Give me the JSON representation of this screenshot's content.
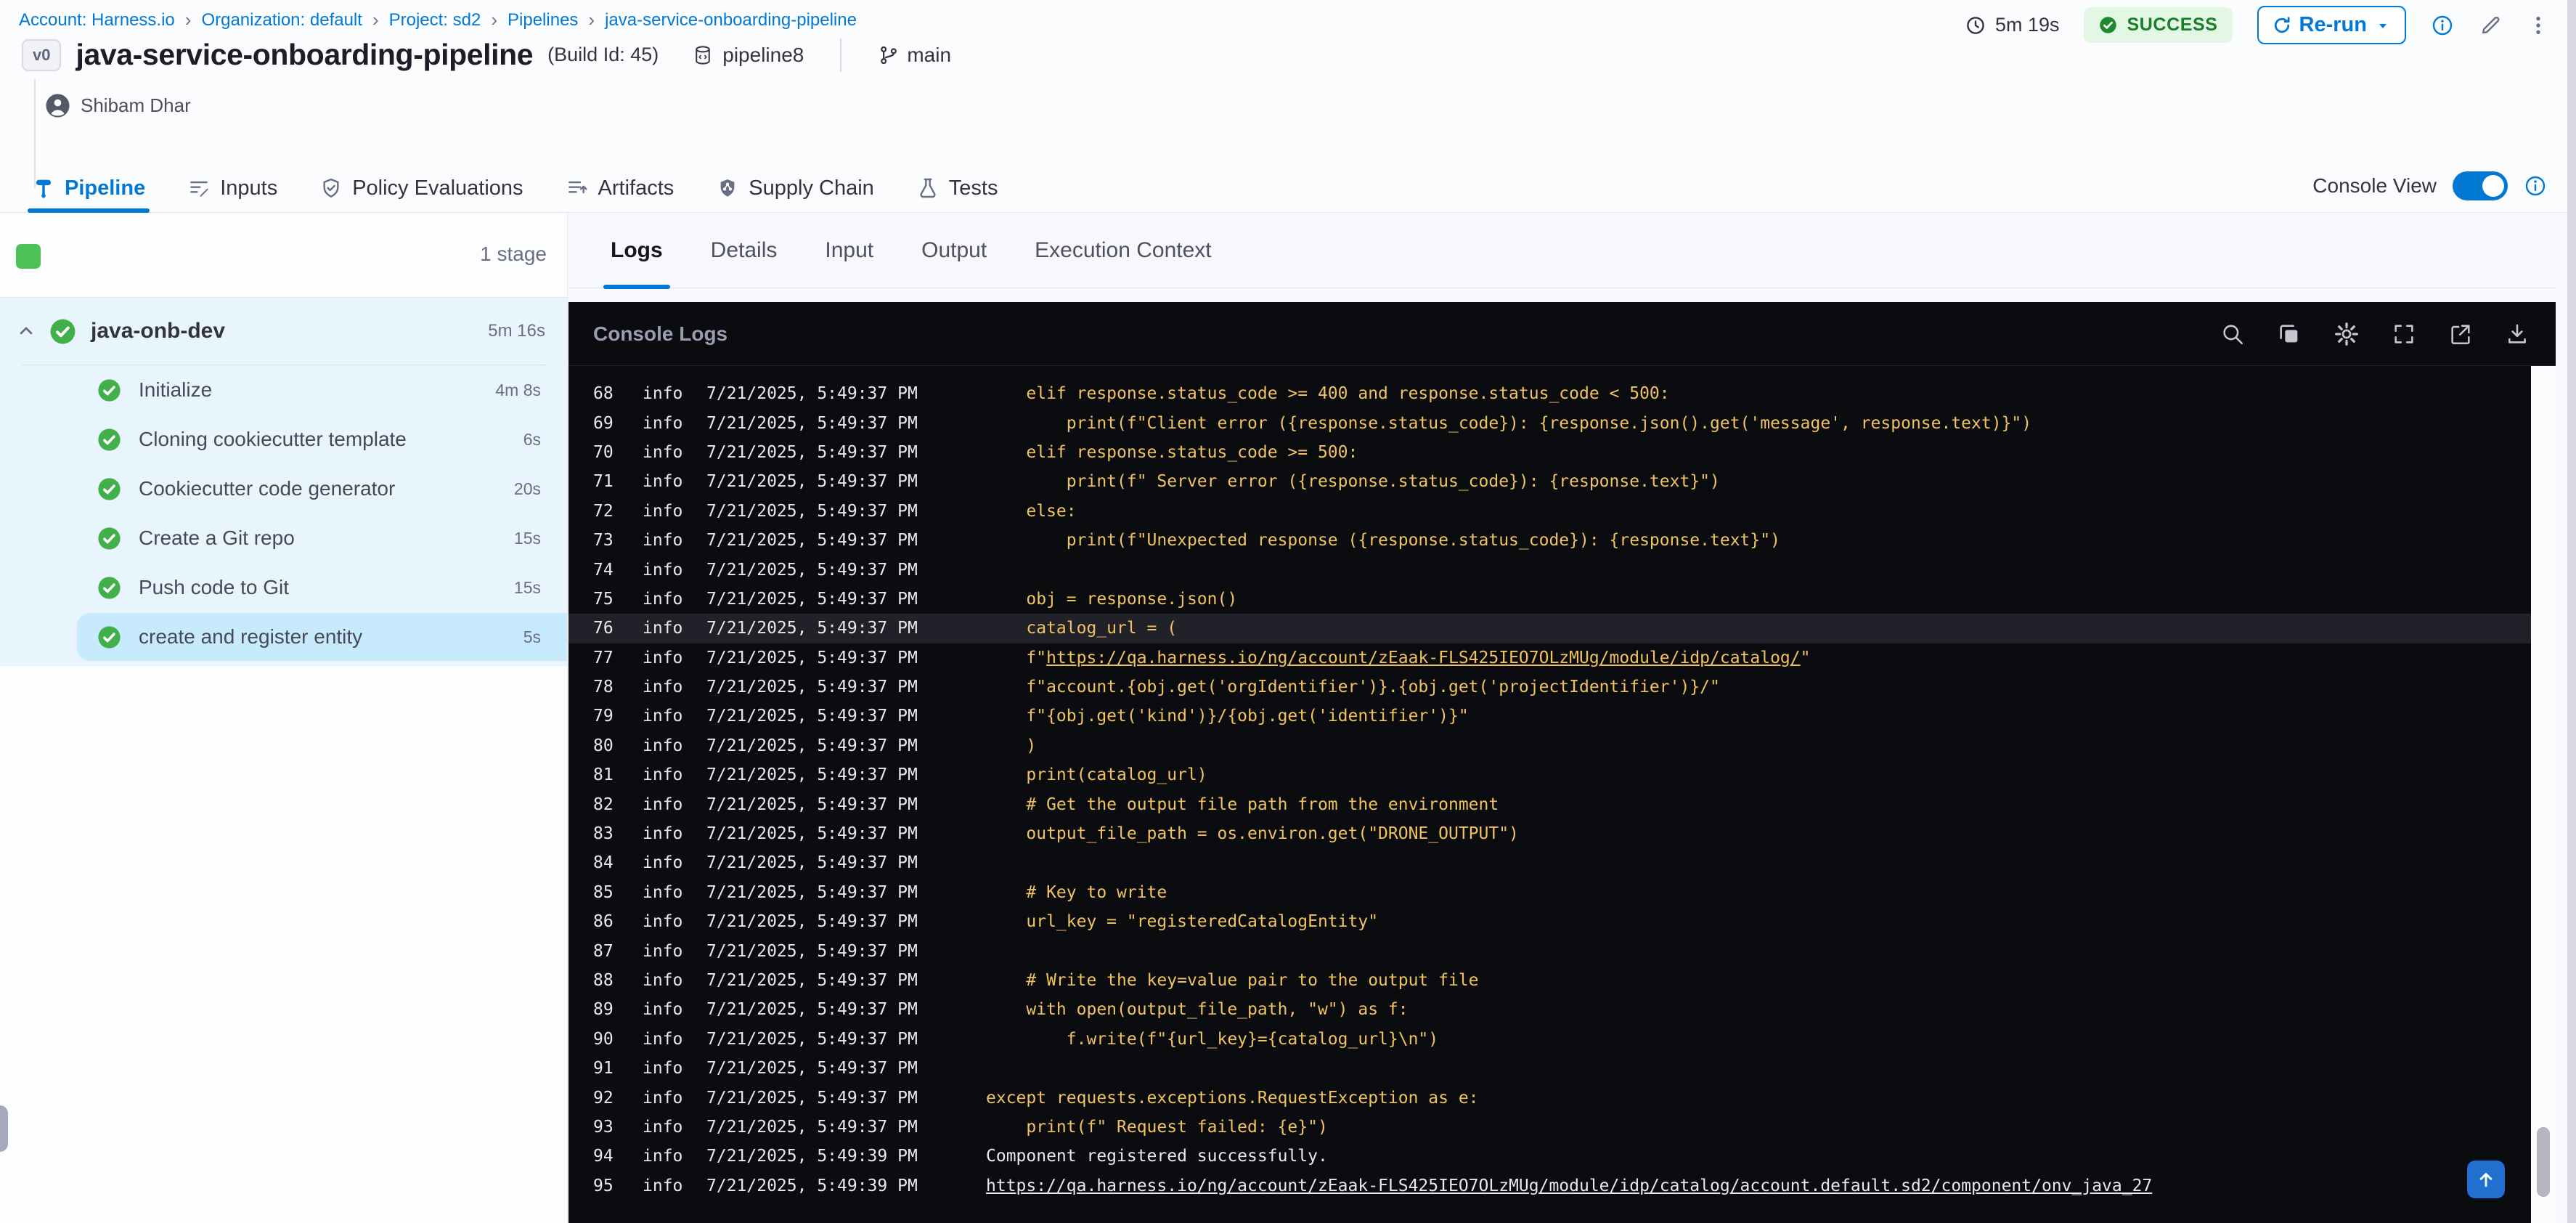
{
  "colors": {
    "accent_blue": "#0278d5",
    "success_green": "#42b04a",
    "log_yellow": "#f1c360",
    "console_bg": "#0b0c10",
    "highlight_row_bg": "#202129",
    "selected_step_bg": "#c7ebfd",
    "stage_block_bg": "#e9f5fc"
  },
  "breadcrumb": {
    "separator": "›",
    "items": [
      "Account: Harness.io",
      "Organization: default",
      "Project: sd2",
      "Pipelines",
      "java-service-onboarding-pipeline"
    ]
  },
  "topbar": {
    "duration": "5m 19s",
    "status_label": "SUCCESS",
    "rerun_label": "Re-run"
  },
  "header": {
    "version_badge": "v0",
    "title": "java-service-onboarding-pipeline",
    "build_id": "(Build Id: 45)",
    "pipeline_chip": "pipeline8",
    "branch": "main",
    "user": "Shibam Dhar"
  },
  "main_tabs": [
    {
      "label": "Pipeline",
      "icon": "pipeline-icon",
      "active": true
    },
    {
      "label": "Inputs",
      "icon": "inputs-icon",
      "active": false
    },
    {
      "label": "Policy Evaluations",
      "icon": "policy-shield-icon",
      "active": false
    },
    {
      "label": "Artifacts",
      "icon": "artifacts-icon",
      "active": false
    },
    {
      "label": "Supply Chain",
      "icon": "supply-chain-shield-icon",
      "active": false
    },
    {
      "label": "Tests",
      "icon": "tests-flask-icon",
      "active": false
    }
  ],
  "tabsbar": {
    "console_view_label": "Console View",
    "console_view_enabled": true
  },
  "sidebar": {
    "stage_count_label": "1 stage",
    "stage": {
      "name": "java-onb-dev",
      "duration": "5m 16s",
      "status": "success"
    },
    "steps": [
      {
        "name": "Initialize",
        "duration": "4m 8s",
        "status": "success",
        "selected": false
      },
      {
        "name": "Cloning cookiecutter template",
        "duration": "6s",
        "status": "success",
        "selected": false
      },
      {
        "name": "Cookiecutter code generator",
        "duration": "20s",
        "status": "success",
        "selected": false
      },
      {
        "name": "Create a Git repo",
        "duration": "15s",
        "status": "success",
        "selected": false
      },
      {
        "name": "Push code to Git",
        "duration": "15s",
        "status": "success",
        "selected": false
      },
      {
        "name": "create and register entity",
        "duration": "5s",
        "status": "success",
        "selected": true
      }
    ]
  },
  "detail_tabs": [
    {
      "label": "Logs",
      "active": true
    },
    {
      "label": "Details",
      "active": false
    },
    {
      "label": "Input",
      "active": false
    },
    {
      "label": "Output",
      "active": false
    },
    {
      "label": "Execution Context",
      "active": false
    }
  ],
  "console": {
    "title": "Console Logs",
    "toolbar_icons": [
      "search-icon",
      "copy-icon",
      "settings-gear-icon",
      "fullscreen-icon",
      "open-in-new-icon",
      "download-icon"
    ],
    "lines": [
      {
        "n": 68,
        "level": "info",
        "ts": "7/21/2025, 5:49:37 PM",
        "kind": "code",
        "highlight": false,
        "segments": [
          {
            "text": "    elif response.status_code >= 400 and response.status_code < 500:"
          }
        ]
      },
      {
        "n": 69,
        "level": "info",
        "ts": "7/21/2025, 5:49:37 PM",
        "kind": "code",
        "highlight": false,
        "segments": [
          {
            "text": "        print(f\"Client error ({response.status_code}): {response.json().get('message', response.text)}\")"
          }
        ]
      },
      {
        "n": 70,
        "level": "info",
        "ts": "7/21/2025, 5:49:37 PM",
        "kind": "code",
        "highlight": false,
        "segments": [
          {
            "text": "    elif response.status_code >= 500:"
          }
        ]
      },
      {
        "n": 71,
        "level": "info",
        "ts": "7/21/2025, 5:49:37 PM",
        "kind": "code",
        "highlight": false,
        "segments": [
          {
            "text": "        print(f\" Server error ({response.status_code}): {response.text}\")"
          }
        ]
      },
      {
        "n": 72,
        "level": "info",
        "ts": "7/21/2025, 5:49:37 PM",
        "kind": "code",
        "highlight": false,
        "segments": [
          {
            "text": "    else:"
          }
        ]
      },
      {
        "n": 73,
        "level": "info",
        "ts": "7/21/2025, 5:49:37 PM",
        "kind": "code",
        "highlight": false,
        "segments": [
          {
            "text": "        print(f\"Unexpected response ({response.status_code}): {response.text}\")"
          }
        ]
      },
      {
        "n": 74,
        "level": "info",
        "ts": "7/21/2025, 5:49:37 PM",
        "kind": "code",
        "highlight": false,
        "segments": [
          {
            "text": ""
          }
        ]
      },
      {
        "n": 75,
        "level": "info",
        "ts": "7/21/2025, 5:49:37 PM",
        "kind": "code",
        "highlight": false,
        "segments": [
          {
            "text": "    obj = response.json()"
          }
        ]
      },
      {
        "n": 76,
        "level": "info",
        "ts": "7/21/2025, 5:49:37 PM",
        "kind": "code",
        "highlight": true,
        "segments": [
          {
            "text": "    catalog_url = ("
          }
        ]
      },
      {
        "n": 77,
        "level": "info",
        "ts": "7/21/2025, 5:49:37 PM",
        "kind": "code",
        "highlight": false,
        "segments": [
          {
            "text": "    f\""
          },
          {
            "text": "https://qa.harness.io/ng/account/zEaak-FLS425IEO7OLzMUg/module/idp/catalog/",
            "link": true
          },
          {
            "text": "\""
          }
        ]
      },
      {
        "n": 78,
        "level": "info",
        "ts": "7/21/2025, 5:49:37 PM",
        "kind": "code",
        "highlight": false,
        "segments": [
          {
            "text": "    f\"account.{obj.get('orgIdentifier')}.{obj.get('projectIdentifier')}/\""
          }
        ]
      },
      {
        "n": 79,
        "level": "info",
        "ts": "7/21/2025, 5:49:37 PM",
        "kind": "code",
        "highlight": false,
        "segments": [
          {
            "text": "    f\"{obj.get('kind')}/{obj.get('identifier')}\""
          }
        ]
      },
      {
        "n": 80,
        "level": "info",
        "ts": "7/21/2025, 5:49:37 PM",
        "kind": "code",
        "highlight": false,
        "segments": [
          {
            "text": "    )"
          }
        ]
      },
      {
        "n": 81,
        "level": "info",
        "ts": "7/21/2025, 5:49:37 PM",
        "kind": "code",
        "highlight": false,
        "segments": [
          {
            "text": "    print(catalog_url)"
          }
        ]
      },
      {
        "n": 82,
        "level": "info",
        "ts": "7/21/2025, 5:49:37 PM",
        "kind": "code",
        "highlight": false,
        "segments": [
          {
            "text": "    # Get the output file path from the environment"
          }
        ]
      },
      {
        "n": 83,
        "level": "info",
        "ts": "7/21/2025, 5:49:37 PM",
        "kind": "code",
        "highlight": false,
        "segments": [
          {
            "text": "    output_file_path = os.environ.get(\"DRONE_OUTPUT\")"
          }
        ]
      },
      {
        "n": 84,
        "level": "info",
        "ts": "7/21/2025, 5:49:37 PM",
        "kind": "code",
        "highlight": false,
        "segments": [
          {
            "text": ""
          }
        ]
      },
      {
        "n": 85,
        "level": "info",
        "ts": "7/21/2025, 5:49:37 PM",
        "kind": "code",
        "highlight": false,
        "segments": [
          {
            "text": "    # Key to write"
          }
        ]
      },
      {
        "n": 86,
        "level": "info",
        "ts": "7/21/2025, 5:49:37 PM",
        "kind": "code",
        "highlight": false,
        "segments": [
          {
            "text": "    url_key = \"registeredCatalogEntity\""
          }
        ]
      },
      {
        "n": 87,
        "level": "info",
        "ts": "7/21/2025, 5:49:37 PM",
        "kind": "code",
        "highlight": false,
        "segments": [
          {
            "text": ""
          }
        ]
      },
      {
        "n": 88,
        "level": "info",
        "ts": "7/21/2025, 5:49:37 PM",
        "kind": "code",
        "highlight": false,
        "segments": [
          {
            "text": "    # Write the key=value pair to the output file"
          }
        ]
      },
      {
        "n": 89,
        "level": "info",
        "ts": "7/21/2025, 5:49:37 PM",
        "kind": "code",
        "highlight": false,
        "segments": [
          {
            "text": "    with open(output_file_path, \"w\") as f:"
          }
        ]
      },
      {
        "n": 90,
        "level": "info",
        "ts": "7/21/2025, 5:49:37 PM",
        "kind": "code",
        "highlight": false,
        "segments": [
          {
            "text": "        f.write(f\"{url_key}={catalog_url}\\n\")"
          }
        ]
      },
      {
        "n": 91,
        "level": "info",
        "ts": "7/21/2025, 5:49:37 PM",
        "kind": "code",
        "highlight": false,
        "segments": [
          {
            "text": ""
          }
        ]
      },
      {
        "n": 92,
        "level": "info",
        "ts": "7/21/2025, 5:49:37 PM",
        "kind": "code",
        "highlight": false,
        "segments": [
          {
            "text": "except requests.exceptions.RequestException as e:"
          }
        ]
      },
      {
        "n": 93,
        "level": "info",
        "ts": "7/21/2025, 5:49:37 PM",
        "kind": "code",
        "highlight": false,
        "segments": [
          {
            "text": "    print(f\" Request failed: {e}\")"
          }
        ]
      },
      {
        "n": 94,
        "level": "info",
        "ts": "7/21/2025, 5:49:39 PM",
        "kind": "plain",
        "highlight": false,
        "segments": [
          {
            "text": "Component registered successfully."
          }
        ]
      },
      {
        "n": 95,
        "level": "info",
        "ts": "7/21/2025, 5:49:39 PM",
        "kind": "plain",
        "highlight": false,
        "segments": [
          {
            "text": "https://qa.harness.io/ng/account/zEaak-FLS425IEO7OLzMUg/module/idp/catalog/account.default.sd2/component/onv_java_27",
            "link": true
          }
        ]
      }
    ]
  }
}
